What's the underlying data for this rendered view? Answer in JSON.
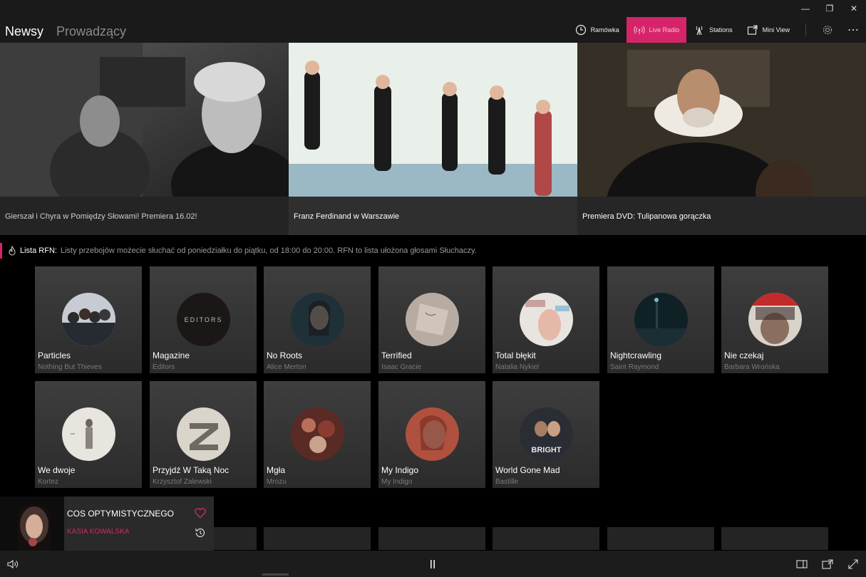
{
  "window": {
    "minimize": "—",
    "restore": "❐",
    "close": "✕"
  },
  "nav": {
    "tabs": [
      {
        "label": "Newsy",
        "active": true
      },
      {
        "label": "Prowadzący",
        "active": false
      }
    ]
  },
  "toolbar": {
    "schedule_label": "Ramówka",
    "live_label": "Live Radio",
    "stations_label": "Stations",
    "miniview_label": "Mini View",
    "settings_icon": "gear-icon",
    "more_label": "⋯"
  },
  "colors": {
    "accent": "#d6246a",
    "background": "#000000",
    "panel": "#1a1a1a"
  },
  "hero": [
    {
      "caption": "Gierszał i Chyra w Pomiędzy Słowami! Premiera 16.02!"
    },
    {
      "caption": "Franz Ferdinand w Warszawie"
    },
    {
      "caption": "Premiera DVD: Tulipanowa gorączka"
    }
  ],
  "info": {
    "label": "Lista RFN:",
    "text": "Listy przebojów możecie słuchać od poniedziałku do piątku, od 18:00 do 20:00. RFN to lista ułożona głosami Słuchaczy."
  },
  "songs": [
    {
      "title": "Particles",
      "artist": "Nothing But Thieves"
    },
    {
      "title": "Magazine",
      "artist": "Editors",
      "cover_text": "EDITORS"
    },
    {
      "title": "No Roots",
      "artist": "Alice Merton"
    },
    {
      "title": "Terrified",
      "artist": "Isaac Gracie"
    },
    {
      "title": "Total błękit",
      "artist": "Natalia Nykiel"
    },
    {
      "title": "Nightcrawling",
      "artist": "Saint Raymond"
    },
    {
      "title": "Nie czekaj",
      "artist": "Barbara Wrońska"
    },
    {
      "title": "We dwoje",
      "artist": "Kortez"
    },
    {
      "title": "Przyjdź W Taką Noc",
      "artist": "Krzysztof Zalewski"
    },
    {
      "title": "Mgła",
      "artist": "Mrozu"
    },
    {
      "title": "My Indigo",
      "artist": "My Indigo"
    },
    {
      "title": "World Gone Mad",
      "artist": "Bastille",
      "cover_text": "BRIGHT"
    }
  ],
  "now_playing": {
    "title": "COS OPTYMISTYCZNEGO",
    "artist": "KASIA KOWALSKA"
  }
}
